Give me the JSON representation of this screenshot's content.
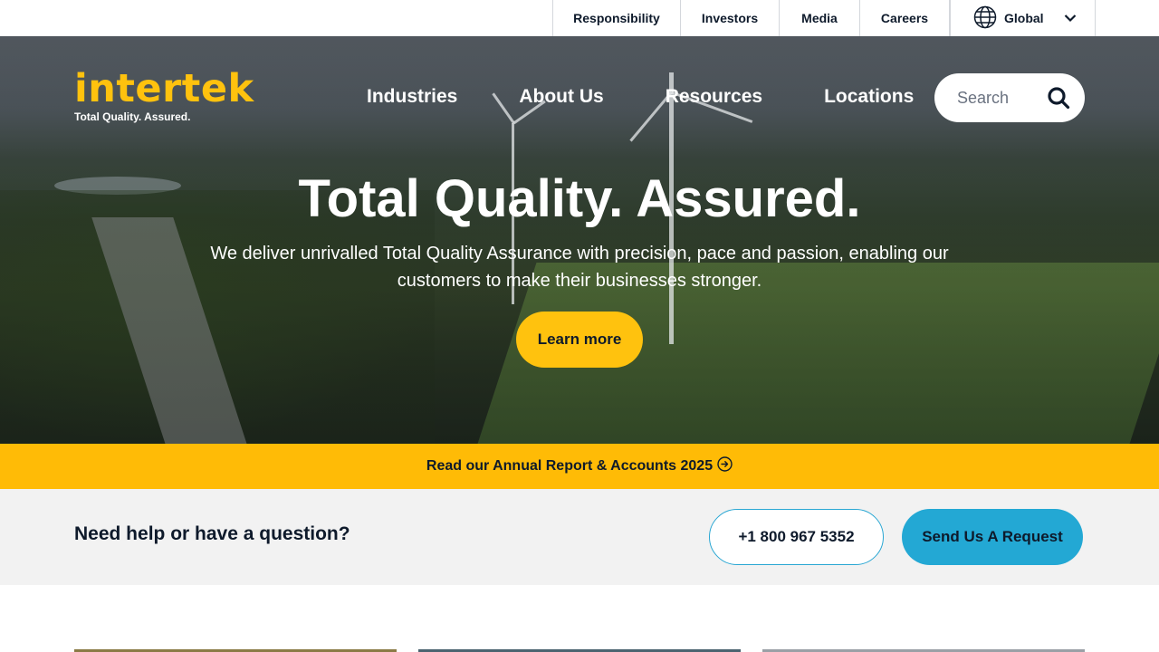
{
  "utility_nav": {
    "links": [
      "Responsibility",
      "Investors",
      "Media",
      "Careers"
    ],
    "region": "Global"
  },
  "header": {
    "logo_text": "intertek",
    "logo_tagline": "Total Quality. Assured.",
    "nav": [
      "Industries",
      "About Us",
      "Resources",
      "Locations"
    ],
    "search_placeholder": "Search"
  },
  "hero": {
    "title": "Total Quality. Assured.",
    "subtitle": "We deliver unrivalled Total Quality Assurance with precision, pace and passion, enabling our customers to make their businesses stronger.",
    "cta": "Learn more"
  },
  "announcement": {
    "text": "Read our Annual Report & Accounts 2025"
  },
  "help": {
    "question": "Need help or have a question?",
    "phone": "+1 800 967 5352",
    "request": "Send Us A Request"
  },
  "colors": {
    "brand_yellow": "#ffc20e",
    "announcement_bg": "#ffbb06",
    "accent_blue": "#23a8d4",
    "text_dark": "#0e1a2b"
  },
  "icons": [
    "globe-icon",
    "chevron-down-icon",
    "search-icon",
    "arrow-right-circle-icon"
  ]
}
